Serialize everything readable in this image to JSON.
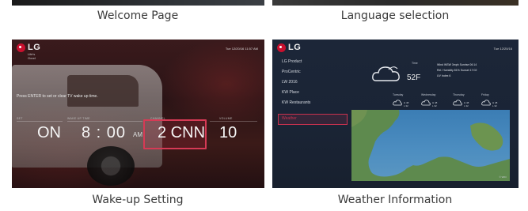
{
  "captions": {
    "welcome": "Welcome Page",
    "language": "Language selection",
    "wakeup": "Wake-up Setting",
    "weather": "Weather Information"
  },
  "wakeup_screen": {
    "brand": "LG",
    "brand_sub": "Life's Good",
    "timestamp": "Tue 12/20/16 11:57 AM",
    "prompt": "Press ENTER to set or clear TV wake up time.",
    "labels": {
      "set": "SET",
      "time": "WAKE UP TIME",
      "channel": "CHANNEL",
      "volume": "VOLUME"
    },
    "values": {
      "set": "ON",
      "time": "8 : 00",
      "ampm": "AM",
      "channel": "2 CNN",
      "volume": "10"
    }
  },
  "weather_screen": {
    "brand": "LG",
    "timestamp": "Tue 12/20/16",
    "menu": [
      "LG Product",
      "ProCentric",
      "LW 2016",
      "KW Place",
      "KW Restaurants",
      "Weather"
    ],
    "selected_index": 5,
    "now_label": "Time",
    "temperature": "52F",
    "stats": {
      "wind": "Wind  WSW 3mph  Sunrise  06:14",
      "humidity": "Rel. Humidity  81%  Sunset  17:02",
      "uv": "UV Index  6"
    },
    "forecast_days": [
      "Tuesday",
      "Wednesday",
      "Thursday",
      "Friday"
    ],
    "forecast": [
      {
        "high": "H 48",
        "low": "L 32"
      },
      {
        "high": "H 48",
        "low": "L 32"
      },
      {
        "high": "H 48",
        "low": "L 32"
      },
      {
        "high": "H 48",
        "low": "L 32"
      }
    ],
    "map_note": "© Wthr"
  },
  "colors": {
    "accent_red": "#d63a55",
    "lg_red": "#c8102e",
    "caption_text": "#3a3a3a"
  }
}
